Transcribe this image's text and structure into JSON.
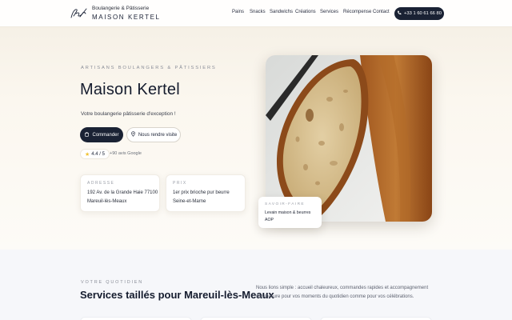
{
  "header": {
    "brand_subtitle": "Boulangerie & Pâtisserie",
    "brand_name": "MAISON KERTEL",
    "nav": [
      "Pains",
      "Snacks",
      "Sandwichs",
      "Créations",
      "Services",
      "Récompense",
      "Contact"
    ],
    "phone": "+33 1 60 61 66 80"
  },
  "hero": {
    "eyebrow": "ARTISANS BOULANGERS & PÂTISSIERS",
    "title": "Maison Kertel",
    "subtitle": "Votre boulangerie pâtisserie d'exception !",
    "order_button": "Commander",
    "visit_button": "Nous rendre visite",
    "rating": "4.4 / 5",
    "reviews": "+90 avis Google",
    "address_card": {
      "label": "ADRESSE",
      "lines": [
        "192 Av. de la Grande Haie 77100",
        "Mareuil-lès-Meaux"
      ]
    },
    "prize_card": {
      "label": "PRIX",
      "lines": [
        "1er prix brioche pur beurre",
        "Seine-et-Marne"
      ]
    },
    "savoir_card": {
      "label": "SAVOIR-FAIRE",
      "lines": [
        "Levain maison & beurres",
        "AOP"
      ]
    }
  },
  "services": {
    "eyebrow": "VOTRE QUOTIDIEN",
    "title": "Services taillés pour Mareuil-lès-Meaux",
    "text_lines": [
      "Nous lions simple : accueil chaleureux, commandes rapides et accompagnement",
      "sur-mesure pour vos moments du quotidien comme pour vos célébrations."
    ]
  },
  "colors": {
    "navy": "#1a2234",
    "cream": "#f4eee3",
    "star": "#f1c232"
  }
}
